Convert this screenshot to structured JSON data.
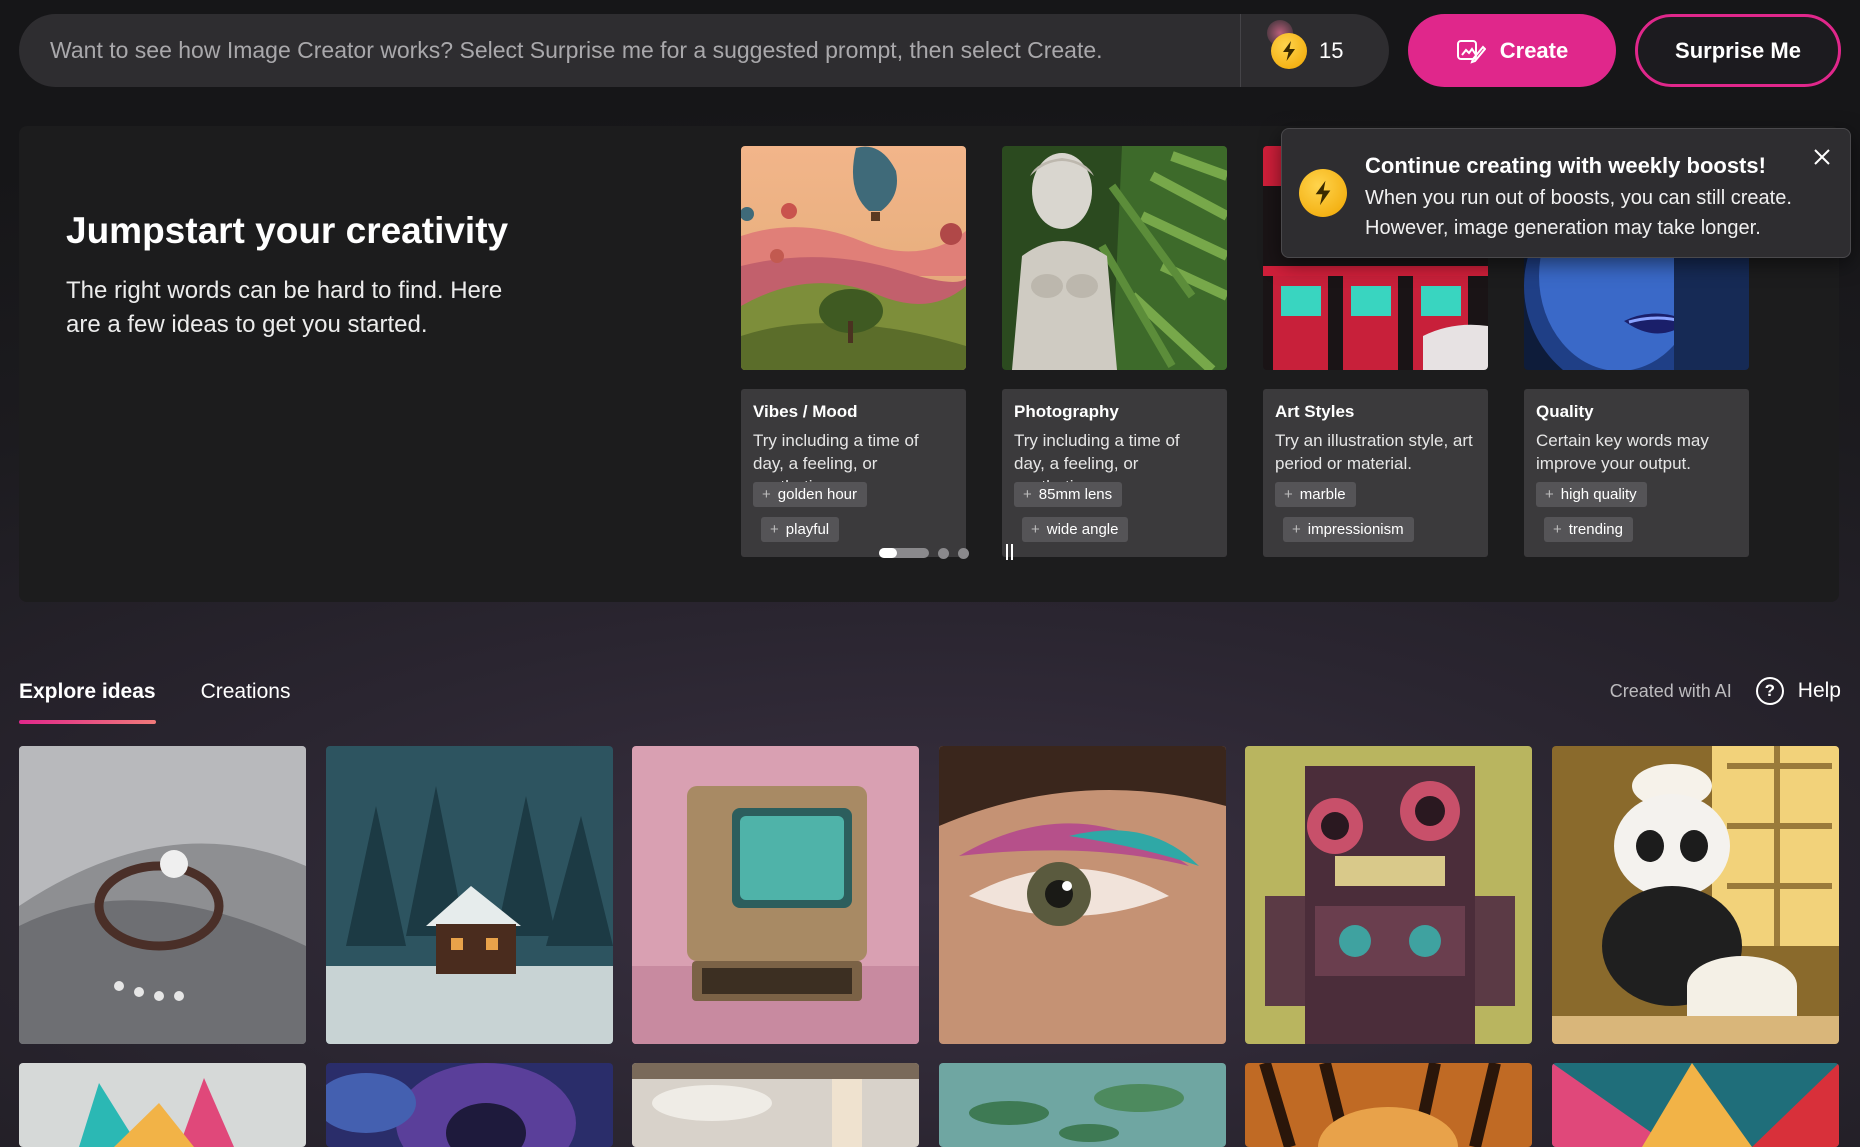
{
  "prompt": {
    "placeholder": "Want to see how Image Creator works? Select Surprise me for a suggested prompt, then select Create.",
    "boosts": "15"
  },
  "buttons": {
    "create": "Create",
    "surprise": "Surprise Me"
  },
  "jumpstart": {
    "title": "Jumpstart your creativity",
    "description": "The right words can be hard to find. Here are a few ideas to get you started.",
    "cards": [
      {
        "name": "Vibes / Mood",
        "text": "Try including a time of day, a feeling, or aesthetic.",
        "chips": [
          "golden hour",
          "playful"
        ]
      },
      {
        "name": "Photography",
        "text": "Try including a time of day, a feeling, or aesthetic.",
        "chips": [
          "85mm lens",
          "wide angle"
        ]
      },
      {
        "name": "Art Styles",
        "text": "Try an illustration style, art period or material.",
        "chips": [
          "marble",
          "impressionism"
        ]
      },
      {
        "name": "Quality",
        "text": "Certain key words may improve your output.",
        "chips": [
          "high quality",
          "trending"
        ]
      }
    ]
  },
  "toast": {
    "title": "Continue creating with weekly boosts!",
    "body": "When you run out of boosts, you can still create. However, image generation may take longer."
  },
  "tabs": [
    {
      "label": "Explore ideas",
      "active": true
    },
    {
      "label": "Creations",
      "active": false
    }
  ],
  "toolbar": {
    "created_with_ai": "Created with AI",
    "help": "Help"
  },
  "colors": {
    "accent": "#e0278b",
    "boost_coin": "#f5b800",
    "panel": "#1c1c1d"
  }
}
